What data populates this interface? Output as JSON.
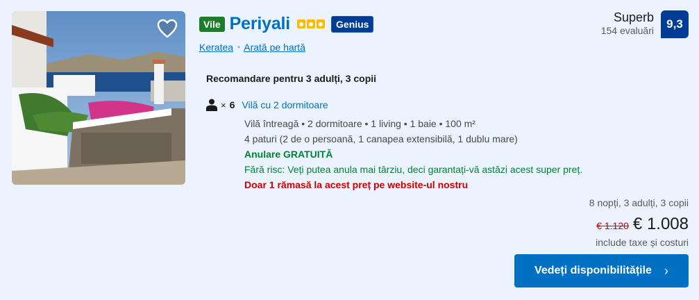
{
  "property": {
    "type_badge": "Vile",
    "name": "Periyali",
    "star_count": 3,
    "genius_label": "Genius",
    "location": "Keratea",
    "map_link": "Arată pe hartă"
  },
  "review": {
    "word": "Superb",
    "count": "154 evaluări",
    "score": "9,3"
  },
  "recommendation": {
    "title": "Recomandare pentru 3 adulți, 3 copii",
    "times": "×",
    "unit_count": "6",
    "unit_name": "Vilă cu 2 dormitoare",
    "details": "Vilă întreagă • 2 dormitoare • 1 living • 1 baie • 100 m²",
    "beds": "4 paturi (2 de o persoană, 1 canapea extensibilă, 1 dublu mare)",
    "free_cancel": "Anulare GRATUITĂ",
    "free_cancel_desc": "Fără risc: Veți putea anula mai târziu, deci garantați-vă astăzi acest super preț.",
    "scarcity": "Doar 1 rămasă la acest preț pe website-ul nostru"
  },
  "price": {
    "stay_info": "8 nopți, 3 adulți, 3 copii",
    "old_price": "€ 1.120",
    "new_price": "€ 1.008",
    "taxes": "include taxe și costuri"
  },
  "cta": {
    "label": "Vedeți disponibilitățile",
    "chevron": "›"
  },
  "colors": {
    "link": "#0071c2",
    "genius": "#003b95",
    "badge_green": "#1f7c2b",
    "star": "#febb02",
    "discount_red": "#cc0000"
  },
  "icons": {
    "favorite": "heart-icon",
    "occupancy": "person-icon",
    "cta": "chevron-right-icon"
  }
}
